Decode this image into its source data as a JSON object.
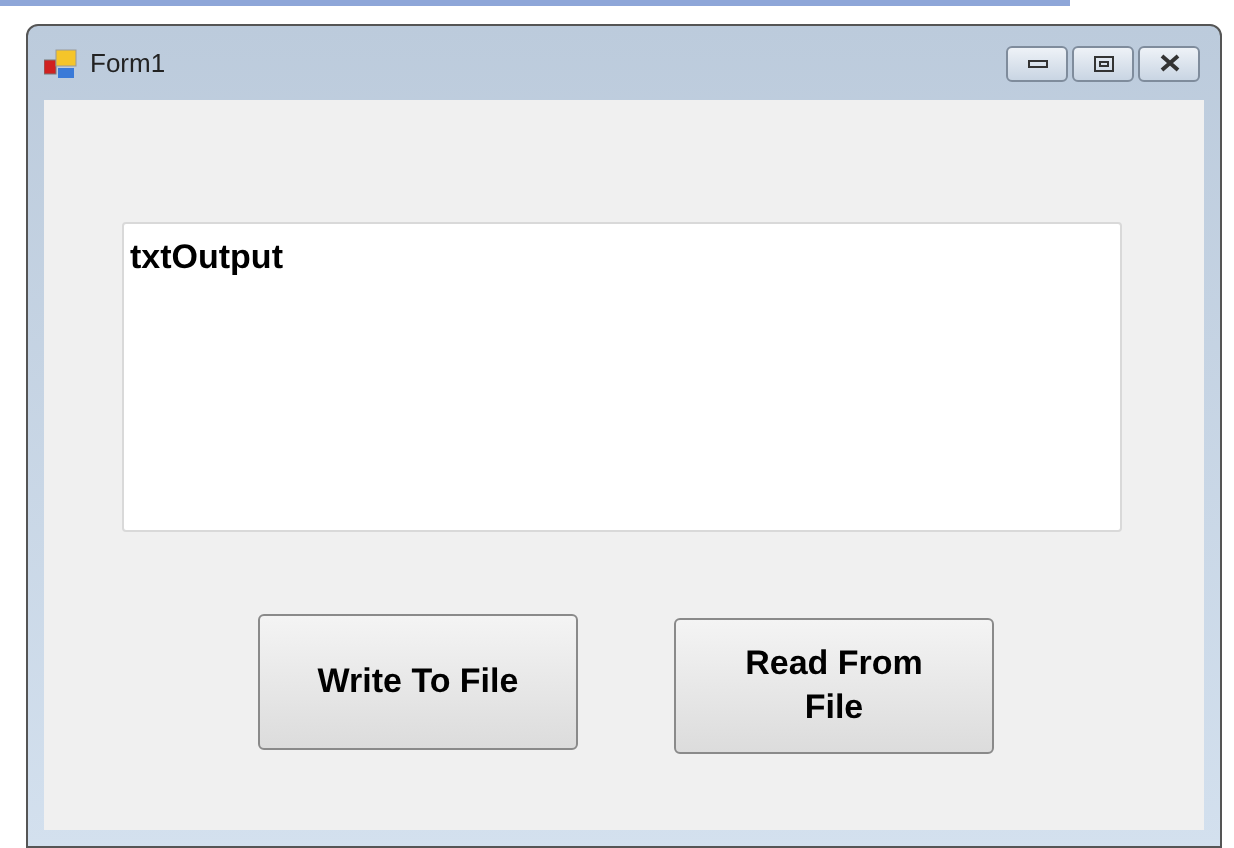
{
  "window": {
    "title": "Form1"
  },
  "textbox": {
    "value": "txtOutput"
  },
  "buttons": [
    {
      "label": "Write To File"
    },
    {
      "label": "Read From File"
    }
  ]
}
